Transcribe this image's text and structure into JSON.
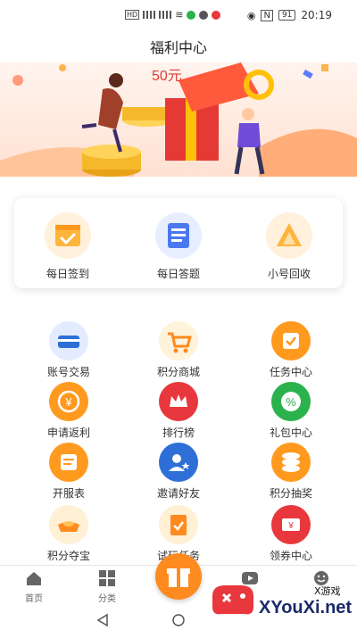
{
  "status": {
    "time": "20:19",
    "battery": "91"
  },
  "header": {
    "title": "福利中心"
  },
  "banner": {
    "amount": "50元"
  },
  "card": {
    "items": [
      {
        "label": "每日签到"
      },
      {
        "label": "每日答题"
      },
      {
        "label": "小号回收"
      }
    ]
  },
  "grid": {
    "items": [
      {
        "label": "账号交易"
      },
      {
        "label": "积分商城"
      },
      {
        "label": "任务中心"
      },
      {
        "label": "申请返利"
      },
      {
        "label": "排行榜"
      },
      {
        "label": "礼包中心"
      },
      {
        "label": "开服表"
      },
      {
        "label": "邀请好友"
      },
      {
        "label": "积分抽奖"
      },
      {
        "label": "积分夺宝"
      },
      {
        "label": "试玩任务"
      },
      {
        "label": "领券中心"
      }
    ]
  },
  "tabbar": {
    "items": [
      {
        "label": "首页"
      },
      {
        "label": "分类"
      }
    ]
  },
  "watermark": {
    "brand": "XYouXi.net",
    "tag": "X游戏"
  },
  "colors": {
    "orange": "#ff8a1f",
    "red": "#e8383d",
    "blue": "#2d6fd6",
    "green": "#2bb24c"
  }
}
